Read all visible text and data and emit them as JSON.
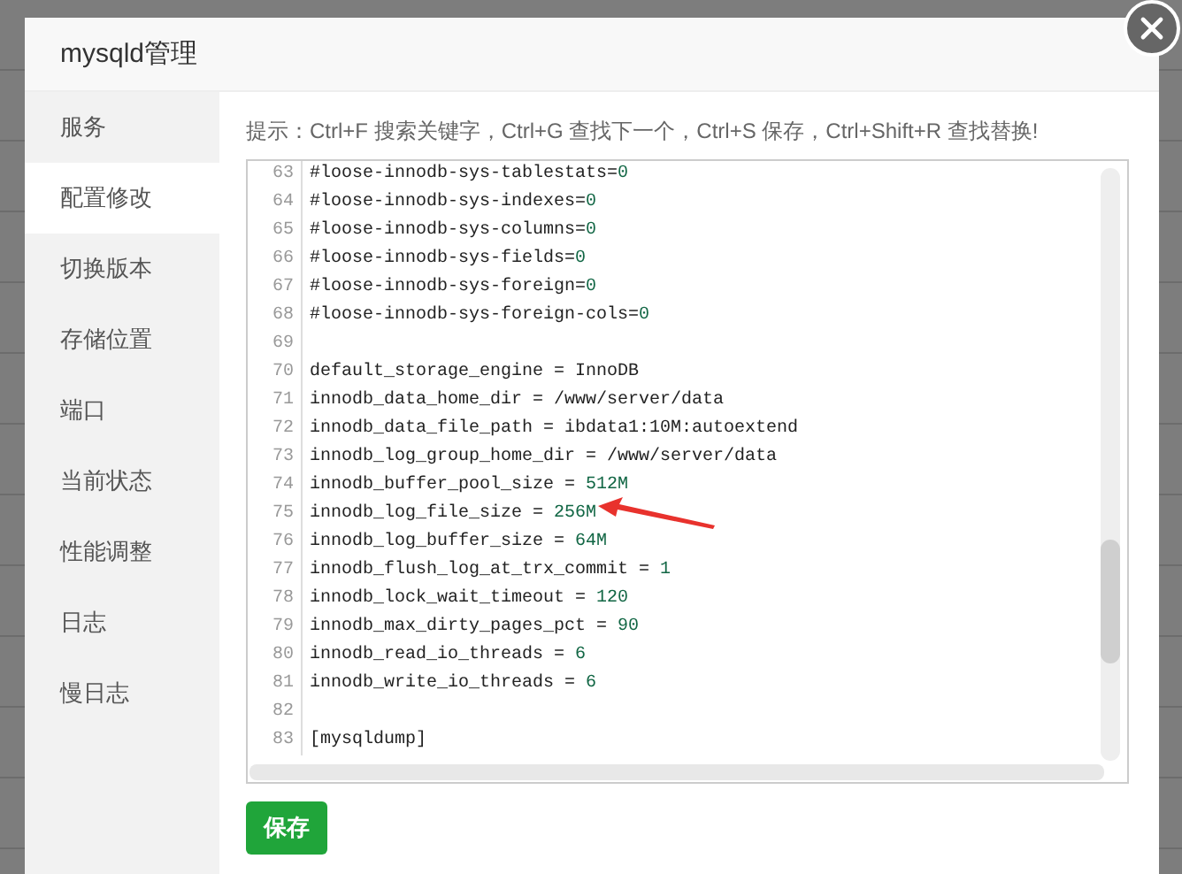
{
  "dialog": {
    "title": "mysqld管理"
  },
  "sidebar": {
    "items": [
      {
        "label": "服务",
        "selected": false
      },
      {
        "label": "配置修改",
        "selected": true
      },
      {
        "label": "切换版本",
        "selected": false
      },
      {
        "label": "存储位置",
        "selected": false
      },
      {
        "label": "端口",
        "selected": false
      },
      {
        "label": "当前状态",
        "selected": false
      },
      {
        "label": "性能调整",
        "selected": false
      },
      {
        "label": "日志",
        "selected": false
      },
      {
        "label": "慢日志",
        "selected": false
      }
    ]
  },
  "hint": "提示：Ctrl+F 搜索关键字，Ctrl+G 查找下一个，Ctrl+S 保存，Ctrl+Shift+R 查找替换!",
  "editor": {
    "lines": [
      {
        "number": "63",
        "text": "#loose-innodb-sys-tablestats=",
        "value": "0"
      },
      {
        "number": "64",
        "text": "#loose-innodb-sys-indexes=",
        "value": "0"
      },
      {
        "number": "65",
        "text": "#loose-innodb-sys-columns=",
        "value": "0"
      },
      {
        "number": "66",
        "text": "#loose-innodb-sys-fields=",
        "value": "0"
      },
      {
        "number": "67",
        "text": "#loose-innodb-sys-foreign=",
        "value": "0"
      },
      {
        "number": "68",
        "text": "#loose-innodb-sys-foreign-cols=",
        "value": "0"
      },
      {
        "number": "69"
      },
      {
        "number": "70",
        "text": "default_storage_engine = InnoDB"
      },
      {
        "number": "71",
        "text": "innodb_data_home_dir = /www/server/data"
      },
      {
        "number": "72",
        "text": "innodb_data_file_path = ibdata1:10M:autoextend"
      },
      {
        "number": "73",
        "text": "innodb_log_group_home_dir = /www/server/data"
      },
      {
        "number": "74",
        "text": "innodb_buffer_pool_size = ",
        "value": "512M"
      },
      {
        "number": "75",
        "text": "innodb_log_file_size = ",
        "value": "256M",
        "annotated": true
      },
      {
        "number": "76",
        "text": "innodb_log_buffer_size = ",
        "value": "64M"
      },
      {
        "number": "77",
        "text": "innodb_flush_log_at_trx_commit = ",
        "value": "1"
      },
      {
        "number": "78",
        "text": "innodb_lock_wait_timeout = ",
        "value": "120"
      },
      {
        "number": "79",
        "text": "innodb_max_dirty_pages_pct = ",
        "value": "90"
      },
      {
        "number": "80",
        "text": "innodb_read_io_threads = ",
        "value": "6"
      },
      {
        "number": "81",
        "text": "innodb_write_io_threads = ",
        "value": "6"
      },
      {
        "number": "82"
      },
      {
        "number": "83",
        "text": "[mysqldump]"
      }
    ]
  },
  "save_button": "保存"
}
